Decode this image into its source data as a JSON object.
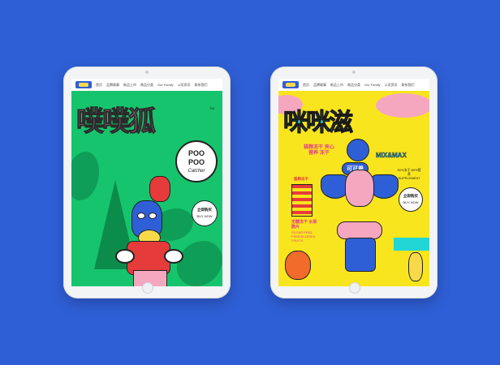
{
  "brand_color": "#2f5fd6",
  "left_tablet": {
    "nav": [
      "首页",
      "品牌故事",
      "新品上市",
      "商品分类",
      "Our Family",
      "公司资讯",
      "联系我们"
    ],
    "title": "噗噗狐",
    "trademark": "TM",
    "badge": {
      "line1": "POO",
      "line2": "POO",
      "line3": "Catcher"
    },
    "buy": {
      "cn": "立即购买",
      "en": "BUY NOW"
    },
    "accent_color": "#17c46e"
  },
  "right_tablet": {
    "nav": [
      "首页",
      "品牌故事",
      "新品上市",
      "商品分类",
      "Our Family",
      "公司资讯",
      "联系我们"
    ],
    "title": "咪咪滋",
    "brand_mark": "MIX&MAX",
    "tagline": "猫粮冻干 夹心营养 冻干",
    "mascot_label": "可可兽",
    "percent_note": "50%冻干 80%营养 SUPPLEMENT",
    "buy": {
      "cn": "立即购买",
      "en": "BUY NOW"
    },
    "side_label": "猫粮冻干",
    "side_text_cn": "无糖冻干 水果脆片",
    "side_text_en": "SUGAR FREE FREEZE-DRIED FRUITS",
    "accent_color": "#f9e51d"
  }
}
